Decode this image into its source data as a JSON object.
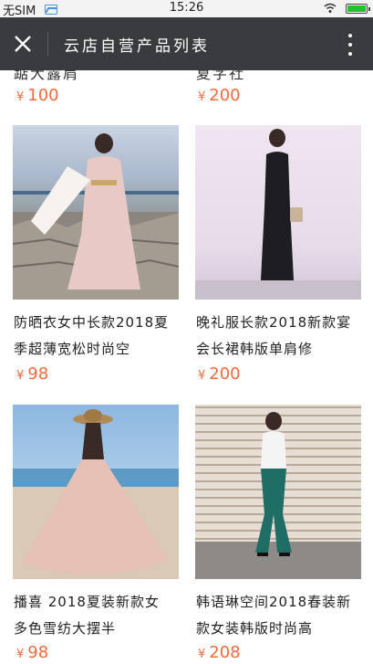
{
  "status_bar": {
    "carrier": "无SIM",
    "time": "15:26",
    "icons": [
      "image-icon",
      "wifi-icon",
      "battery-icon"
    ]
  },
  "header": {
    "title": "云店自营产品列表",
    "close_icon": "close-icon",
    "more_icon": "more-icon"
  },
  "products": [
    {
      "title": "踮大露肩",
      "currency": "¥",
      "price": "100",
      "partial": true
    },
    {
      "title": "夏字社",
      "currency": "¥",
      "price": "200",
      "partial": true
    },
    {
      "title": "防晒衣女中长款2018夏季超薄宽松时尚空",
      "title_line1": "防晒衣女中长款2018夏",
      "title_line2": "季超薄宽松时尚空",
      "currency": "¥",
      "price": "98"
    },
    {
      "title": "晚礼服长款2018新款宴会长裙韩版单肩修",
      "title_line1": "晚礼服长款2018新款宴",
      "title_line2": "会长裙韩版单肩修",
      "currency": "¥",
      "price": "200"
    },
    {
      "title": "播喜 2018夏装新款女多色雪纺大摆半",
      "title_line1": "播喜 2018夏装新款女",
      "title_line2": "多色雪纺大摆半",
      "currency": "¥",
      "price": "98"
    },
    {
      "title": "韩语琳空间2018春装新款女装韩版时尚高",
      "title_line1": "韩语琳空间2018春装新",
      "title_line2": "款女装韩版时尚高",
      "currency": "¥",
      "price": "208"
    }
  ],
  "colors": {
    "header_bg": "#3a3b3f",
    "price": "#f06b3f",
    "status_bg": "#f3f3f3"
  }
}
